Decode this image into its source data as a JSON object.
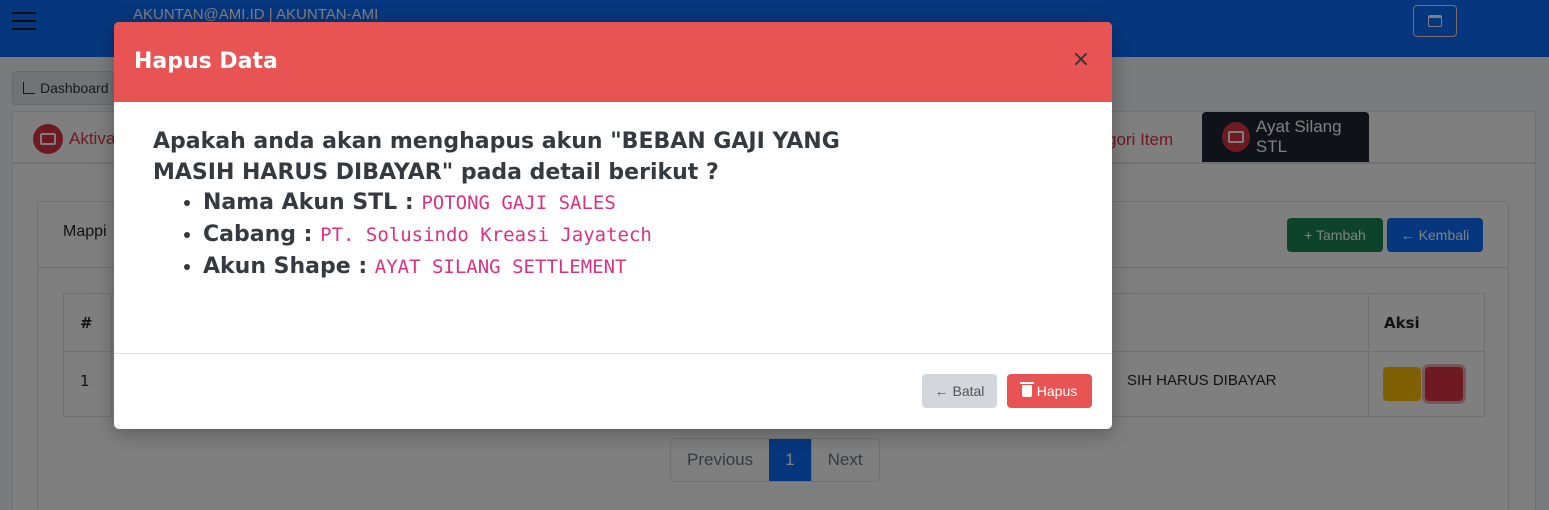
{
  "topbar": {
    "account": "AKUNTAN@AMI.ID | AKUNTAN-AMI"
  },
  "breadcrumb": {
    "dashboard": "Dashboard"
  },
  "tabs": {
    "left_partial": "Aktiva",
    "mid_partial": "gori Item",
    "active": "Ayat Silang STL"
  },
  "card": {
    "title_partial": "Mappi",
    "add_button": "+ Tambah",
    "back_button": "← Kembali"
  },
  "table": {
    "headers": {
      "num": "#",
      "aksi": "Aksi"
    },
    "rows": [
      {
        "num": "1",
        "akun_partial": "SIH HARUS DIBAYAR"
      }
    ]
  },
  "pagination": {
    "previous": "Previous",
    "page": "1",
    "next": "Next"
  },
  "modal": {
    "title": "Hapus Data",
    "close": "×",
    "question": "Apakah anda akan menghapus akun \"BEBAN GAJI YANG MASIH HARUS DIBAYAR\" pada detail berikut ?",
    "details": [
      {
        "label": "Nama Akun STL :",
        "value": "POTONG GAJI SALES"
      },
      {
        "label": "Cabang :",
        "value": "PT. Solusindo Kreasi Jayatech"
      },
      {
        "label": "Akun Shape :",
        "value": "AYAT SILANG SETTLEMENT"
      }
    ],
    "cancel_button": "← Batal",
    "delete_button": "Hapus"
  },
  "colors": {
    "modal_header": "#e85353",
    "topbar": "#0d6efd",
    "detail_value": "#d63384"
  }
}
